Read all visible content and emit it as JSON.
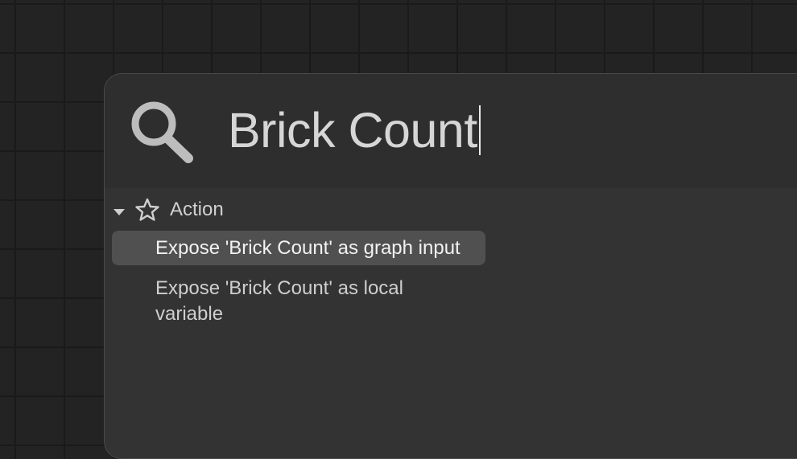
{
  "search": {
    "query": "Brick Count",
    "icon": "search-icon"
  },
  "results": {
    "category": {
      "label": "Action",
      "expanded": true,
      "icon": "star-icon",
      "toggle_icon": "chevron-down-icon"
    },
    "items": [
      {
        "label": "Expose 'Brick Count' as graph input",
        "selected": true
      },
      {
        "label": "Expose 'Brick Count' as local variable",
        "selected": false
      }
    ]
  },
  "colors": {
    "canvas": "#232323",
    "grid_line": "#1a1a1a",
    "panel": "#313131",
    "selection": "#505050",
    "text": "#d0d0d0"
  }
}
